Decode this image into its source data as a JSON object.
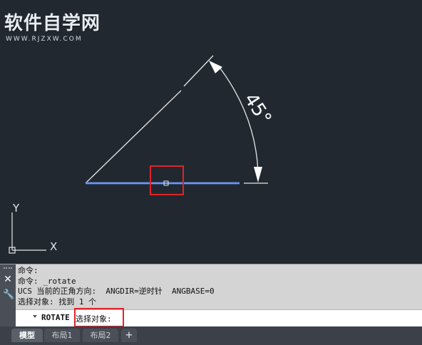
{
  "watermark": {
    "title": "软件自学网",
    "url": "WWW.RJZXW.COM"
  },
  "drawing": {
    "angle_label": "45°",
    "axis_y_label": "Y",
    "axis_x_label": "X"
  },
  "command_line": {
    "history": [
      "命令:",
      "命令: _rotate",
      "UCS 当前的正角方向:  ANGDIR=逆时针  ANGBASE=0",
      "选择对象: 找到 1 个"
    ],
    "current_command": "ROTATE",
    "prompt": "选择对象:"
  },
  "tabs": [
    {
      "label": "模型",
      "active": true
    },
    {
      "label": "布局1",
      "active": false
    },
    {
      "label": "布局2",
      "active": false
    },
    {
      "label": "+",
      "active": false
    }
  ],
  "colors": {
    "background": "#212830",
    "selected_line": "#4a78d8",
    "highlight": "#e0242a"
  }
}
